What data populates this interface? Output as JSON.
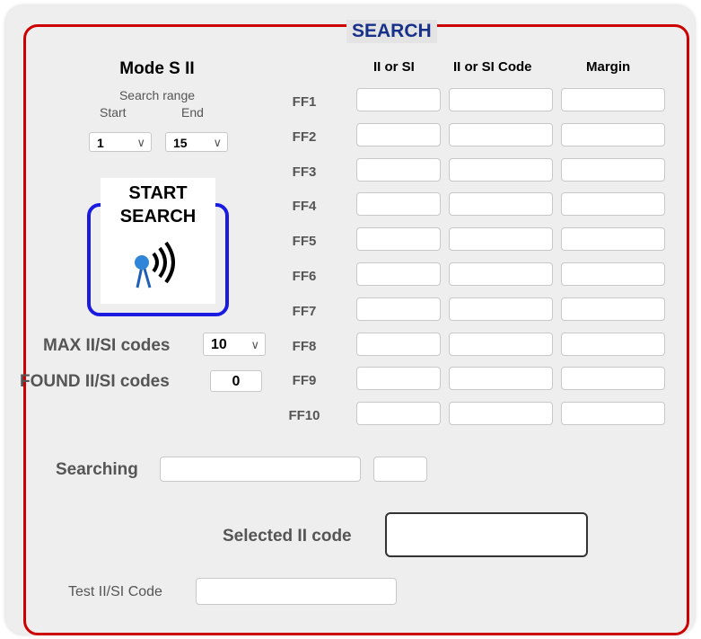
{
  "title": "SEARCH",
  "mode": {
    "heading": "Mode S II",
    "search_range_label": "Search range",
    "start_label": "Start",
    "end_label": "End",
    "start_value": "1",
    "end_value": "15"
  },
  "start_button": {
    "line1": "START",
    "line2": "SEARCH",
    "icon": "radar-signal-icon"
  },
  "max_codes": {
    "label": "MAX II/SI codes",
    "value": "10"
  },
  "found_codes": {
    "label": "FOUND II/SI codes",
    "value": "0"
  },
  "columns": [
    "II or SI",
    "II or SI Code",
    "Margin"
  ],
  "rows": [
    "FF1",
    "FF2",
    "FF3",
    "FF4",
    "FF5",
    "FF6",
    "FF7",
    "FF8",
    "FF9",
    "FF10"
  ],
  "searching": {
    "label": "Searching",
    "value": "",
    "extra": ""
  },
  "selected": {
    "label": "Selected II code",
    "value": ""
  },
  "test": {
    "label": "Test II/SI Code",
    "value": ""
  },
  "colors": {
    "frame": "#cc0000",
    "title": "#17318a",
    "start_border": "#1a1ae0"
  }
}
